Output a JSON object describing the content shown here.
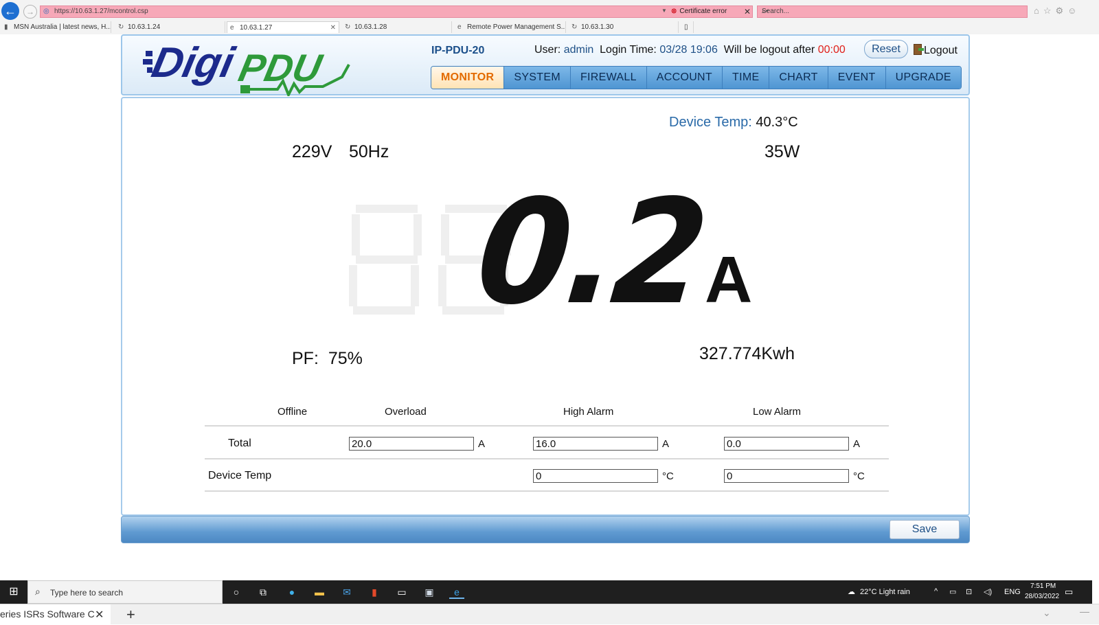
{
  "browser": {
    "url": "https://10.63.1.27/mcontrol.csp",
    "cert_error": "Certificate error",
    "search_placeholder": "Search...",
    "tabs": [
      {
        "label": "MSN Australia | latest news, H..."
      },
      {
        "label": "10.63.1.24"
      },
      {
        "label": "10.63.1.27"
      },
      {
        "label": "10.63.1.28"
      },
      {
        "label": "Remote Power Management S..."
      },
      {
        "label": "10.63.1.30"
      }
    ]
  },
  "header": {
    "device_name": "IP-PDU-20",
    "user_label": "User:",
    "user": "admin",
    "login_label": "Login Time:",
    "login_time": "03/28 19:06",
    "logout_label": "Will be logout after",
    "logout_countdown": "00:00",
    "reset_label": "Reset",
    "logout_button": "Logout",
    "nav": [
      "MONITOR",
      "SYSTEM",
      "FIREWALL",
      "ACCOUNT",
      "TIME",
      "CHART",
      "EVENT",
      "UPGRADE"
    ],
    "active_nav": "MONITOR"
  },
  "monitor": {
    "device_temp_label": "Device Temp:",
    "device_temp_value": "40.3°C",
    "voltage": "229V",
    "frequency": "50Hz",
    "power": "35W",
    "current": "0.2",
    "current_unit": "A",
    "pf_label": "PF:",
    "pf_value": "75%",
    "energy": "327.774Kwh"
  },
  "alarm_table": {
    "headers": [
      "Offline",
      "Overload",
      "High Alarm",
      "Low Alarm"
    ],
    "rows": [
      {
        "label": "Total",
        "overload": "20.0",
        "high": "16.0",
        "low": "0.0",
        "unit": "A"
      },
      {
        "label": "Device Temp",
        "high": "0",
        "low": "0",
        "unit": "°C"
      }
    ]
  },
  "save_label": "Save",
  "taskbar": {
    "search_placeholder": "Type here to search",
    "weather": "22°C  Light rain",
    "lang": "ENG",
    "time": "7:51 PM",
    "date": "28/03/2022"
  },
  "outer_browser": {
    "tab_label": "eries ISRs Software C"
  },
  "colors": {
    "nav_active": "#e36a00",
    "accent_blue": "#1d4f86",
    "alert_red": "#e0201a"
  }
}
